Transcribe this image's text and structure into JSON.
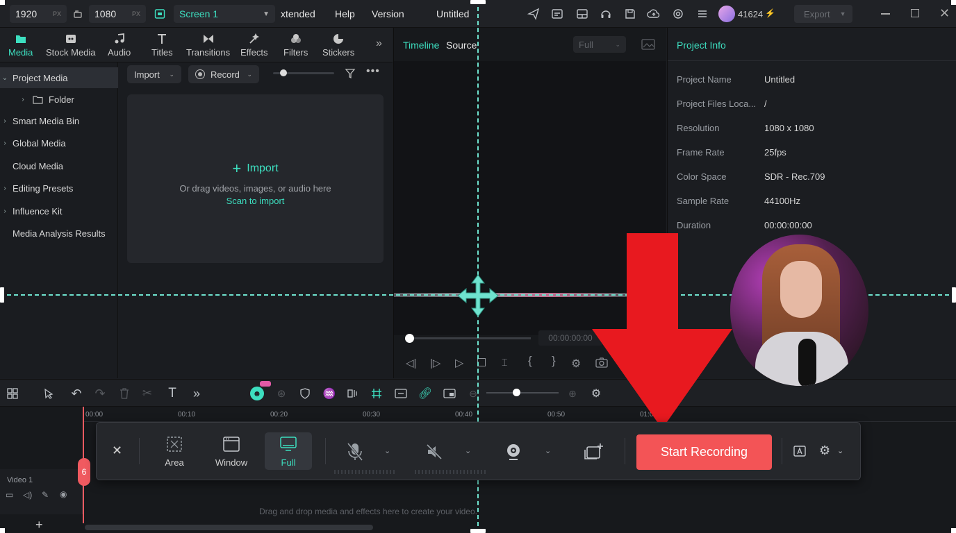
{
  "top_bar": {
    "width_value": "1920",
    "height_value": "1080",
    "unit": "PX",
    "screen_select": "Screen 1",
    "menu_partial": "xtended",
    "menu_help": "Help",
    "menu_version": "Version",
    "project_title": "Untitled",
    "credits": "41624",
    "export_label": "Export"
  },
  "media_tabs": [
    {
      "label": "Media",
      "icon": "media-icon",
      "active": true
    },
    {
      "label": "Stock Media",
      "icon": "stock-media-icon"
    },
    {
      "label": "Audio",
      "icon": "music-note-icon"
    },
    {
      "label": "Titles",
      "icon": "titles-icon"
    },
    {
      "label": "Transitions",
      "icon": "transitions-icon"
    },
    {
      "label": "Effects",
      "icon": "effects-icon"
    },
    {
      "label": "Filters",
      "icon": "filters-icon"
    },
    {
      "label": "Stickers",
      "icon": "stickers-icon"
    }
  ],
  "tree": [
    {
      "label": "Project Media",
      "selected": true,
      "expand": "open"
    },
    {
      "label": "Folder",
      "child": true,
      "expand": "closed"
    },
    {
      "label": "Smart Media Bin",
      "expand": "closed"
    },
    {
      "label": "Global Media",
      "expand": "closed"
    },
    {
      "label": "Cloud Media",
      "expand": "none"
    },
    {
      "label": "Editing Presets",
      "expand": "closed"
    },
    {
      "label": "Influence Kit",
      "expand": "closed"
    },
    {
      "label": "Media Analysis Results",
      "expand": "none"
    }
  ],
  "media_area": {
    "import_dropdown": "Import",
    "record_dropdown": "Record",
    "import_link": "Import",
    "drag_hint": "Or drag videos, images, or audio here",
    "scan_link": "Scan to import"
  },
  "preview": {
    "tab_timeline": "Timeline",
    "tab_source": "Source",
    "quality": "Full",
    "timecode": "00:00:00:00",
    "bracket_in": "{",
    "bracket_out": "}"
  },
  "project_info": {
    "title": "Project Info",
    "rows": [
      {
        "label": "Project Name",
        "value": "Untitled"
      },
      {
        "label": "Project Files Loca...",
        "value": "/"
      },
      {
        "label": "Resolution",
        "value": "1080 x 1080"
      },
      {
        "label": "Frame Rate",
        "value": "25fps"
      },
      {
        "label": "Color Space",
        "value": "SDR - Rec.709"
      },
      {
        "label": "Sample Rate",
        "value": "44100Hz"
      },
      {
        "label": "Duration",
        "value": "00:00:00:00"
      }
    ]
  },
  "timeline": {
    "ticks": [
      "00:00",
      "00:10",
      "00:20",
      "00:30",
      "00:40",
      "00:50",
      "01:0"
    ],
    "track_label": "Video 1",
    "drop_hint": "Drag and drop media and effects here to create your video.",
    "playhead_marker": "6"
  },
  "record_bar": {
    "modes": [
      {
        "label": "Area",
        "icon": "area-select-icon"
      },
      {
        "label": "Window",
        "icon": "window-icon"
      },
      {
        "label": "Full",
        "icon": "monitor-icon",
        "active": true
      }
    ],
    "start_label": "Start Recording",
    "colors": {
      "start": "#f35456",
      "accent": "#3ddfc0"
    }
  },
  "guide_color": "#6fe3cf",
  "arrow_color": "#e8191f"
}
